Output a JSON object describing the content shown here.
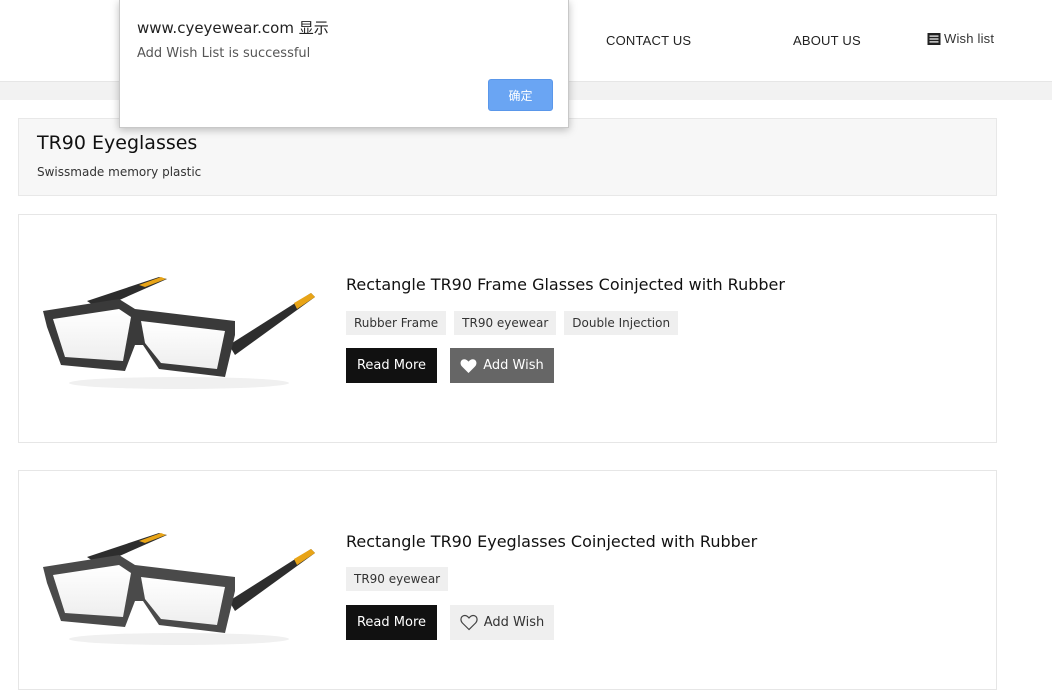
{
  "header": {
    "nav": {
      "contact": "CONTACT US",
      "about": "ABOUT US",
      "wishlist": "Wish list"
    }
  },
  "category": {
    "title": "TR90 Eyeglasses",
    "subtitle": "Swissmade memory plastic"
  },
  "products": [
    {
      "title": "Rectangle TR90 Frame Glasses Coinjected with Rubber",
      "tags": [
        "Rubber Frame",
        "TR90 eyewear",
        "Double Injection"
      ],
      "read_more": "Read More",
      "add_wish": "Add Wish",
      "wish_state": "hovered"
    },
    {
      "title": "Rectangle TR90 Eyeglasses Coinjected with Rubber",
      "tags": [
        "TR90 eyewear"
      ],
      "read_more": "Read More",
      "add_wish": "Add Wish",
      "wish_state": "normal"
    }
  ],
  "dialog": {
    "title": "www.cyeyewear.com 显示",
    "message": "Add Wish List is successful",
    "ok_label": "确定"
  },
  "colors": {
    "dialog_button": "#6aa5f3",
    "read_more_bg": "#111111",
    "wish_active_bg": "#666666",
    "frame_accent": "#e8a417"
  },
  "icons": {
    "wishlist": "list-icon",
    "wish": "heart-icon"
  }
}
